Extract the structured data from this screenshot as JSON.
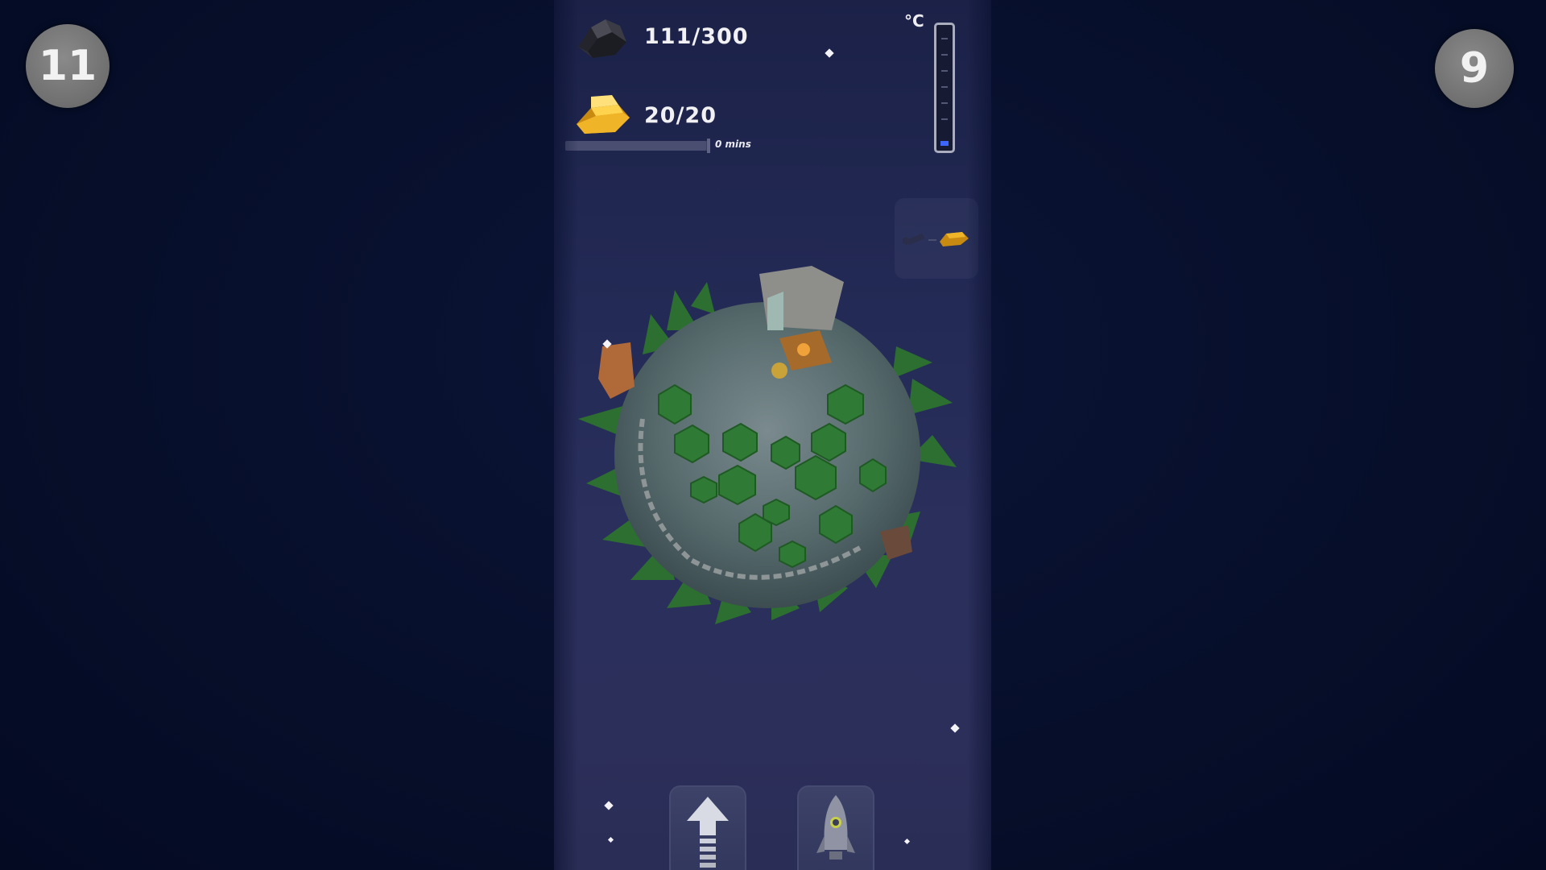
{
  "hud": {
    "left_badge": "11",
    "right_badge": "9"
  },
  "resources": {
    "stone": {
      "icon": "stone-icon",
      "value": "111/300"
    },
    "gold": {
      "icon": "gold-bar-icon",
      "value": "20/20"
    }
  },
  "timer": {
    "label": "0 mins",
    "progress": 0.97
  },
  "temperature": {
    "unit": "°C",
    "level": 0.04,
    "fill_color": "#3d66ff"
  },
  "trade_card": {
    "icons": [
      "rocket-icon",
      "arrow-icon",
      "gold-bar-icon"
    ]
  },
  "planet": {
    "icon": "planet-icon"
  },
  "buttons": {
    "upgrade": {
      "icon": "up-arrow-icon"
    },
    "launch": {
      "icon": "rocket-icon"
    }
  },
  "colors": {
    "background": "#060d2b",
    "panel": "#232a55",
    "foliage": "#2f7a35",
    "gold": "#f0b429",
    "thermometer": "#3d66ff"
  }
}
